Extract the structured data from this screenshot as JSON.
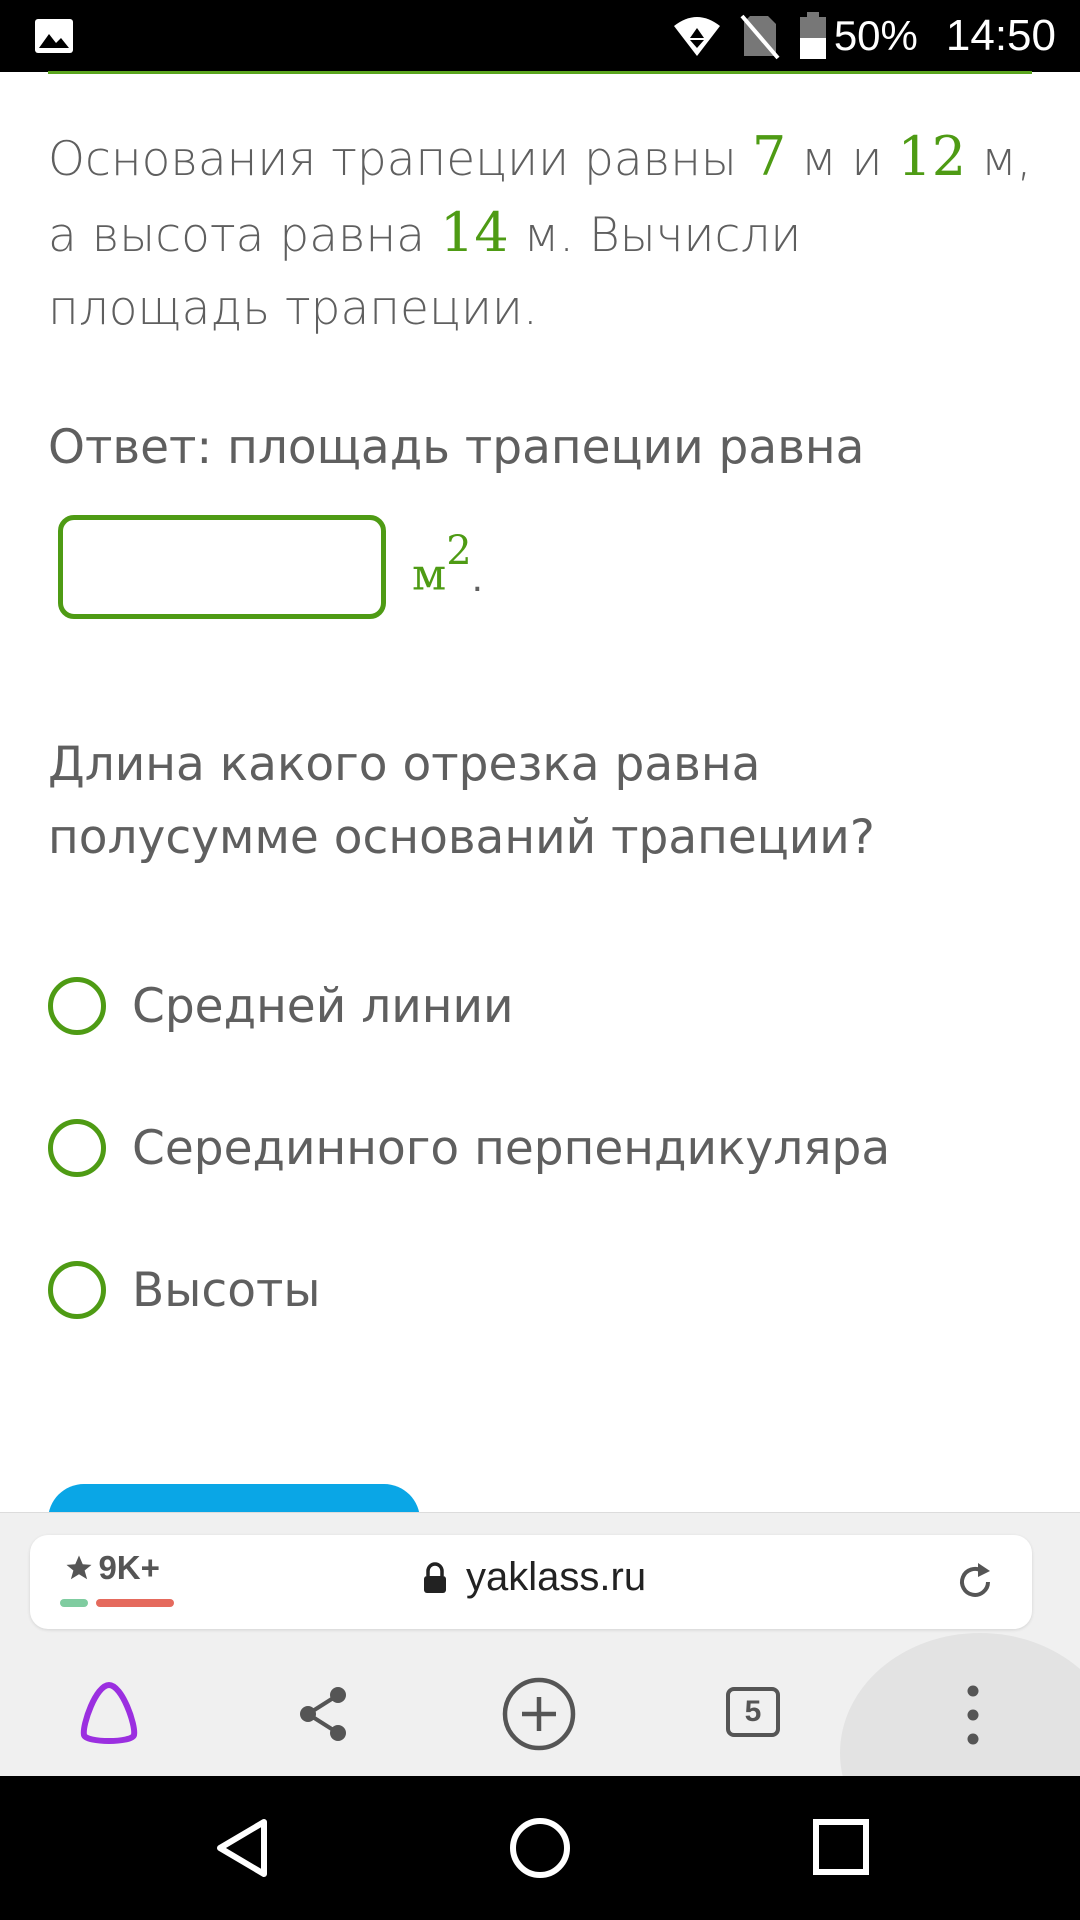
{
  "status_bar": {
    "battery": "50%",
    "time": "14:50"
  },
  "question1": {
    "part1": "Основания трапеции равны ",
    "num1": "7",
    "part2": " м и ",
    "num2": "12",
    "part3": " м, а высота равна ",
    "num3": "14",
    "part4": " м. Вычисли площадь трапеции."
  },
  "answer": {
    "label": "Ответ: площадь трапеции равна",
    "input_value": "",
    "unit": "м",
    "unit_power": "2",
    "end": "."
  },
  "question2": {
    "text": "Длина какого отрезка равна полусумме оснований трапеции?",
    "options": [
      {
        "label": "Средней линии",
        "selected": false
      },
      {
        "label": "Серединного перпендикуляра",
        "selected": false
      },
      {
        "label": "Высоты",
        "selected": false
      }
    ]
  },
  "browser": {
    "rating": "9K+",
    "url": "yaklass.ru",
    "tab_count": "5"
  },
  "colors": {
    "accent_green": "#4e9b14",
    "text_gray": "#5f5f5f",
    "button_blue": "#0aa6e6",
    "alice_purple": "#8a2be2"
  },
  "icons": [
    "gallery-icon",
    "wifi-icon",
    "no-sim-icon",
    "battery-icon",
    "star-icon",
    "lock-icon",
    "reload-icon",
    "alice-icon",
    "share-icon",
    "add-tab-icon",
    "tabs-icon",
    "menu-dots-icon",
    "back-icon",
    "home-icon",
    "recents-icon"
  ]
}
